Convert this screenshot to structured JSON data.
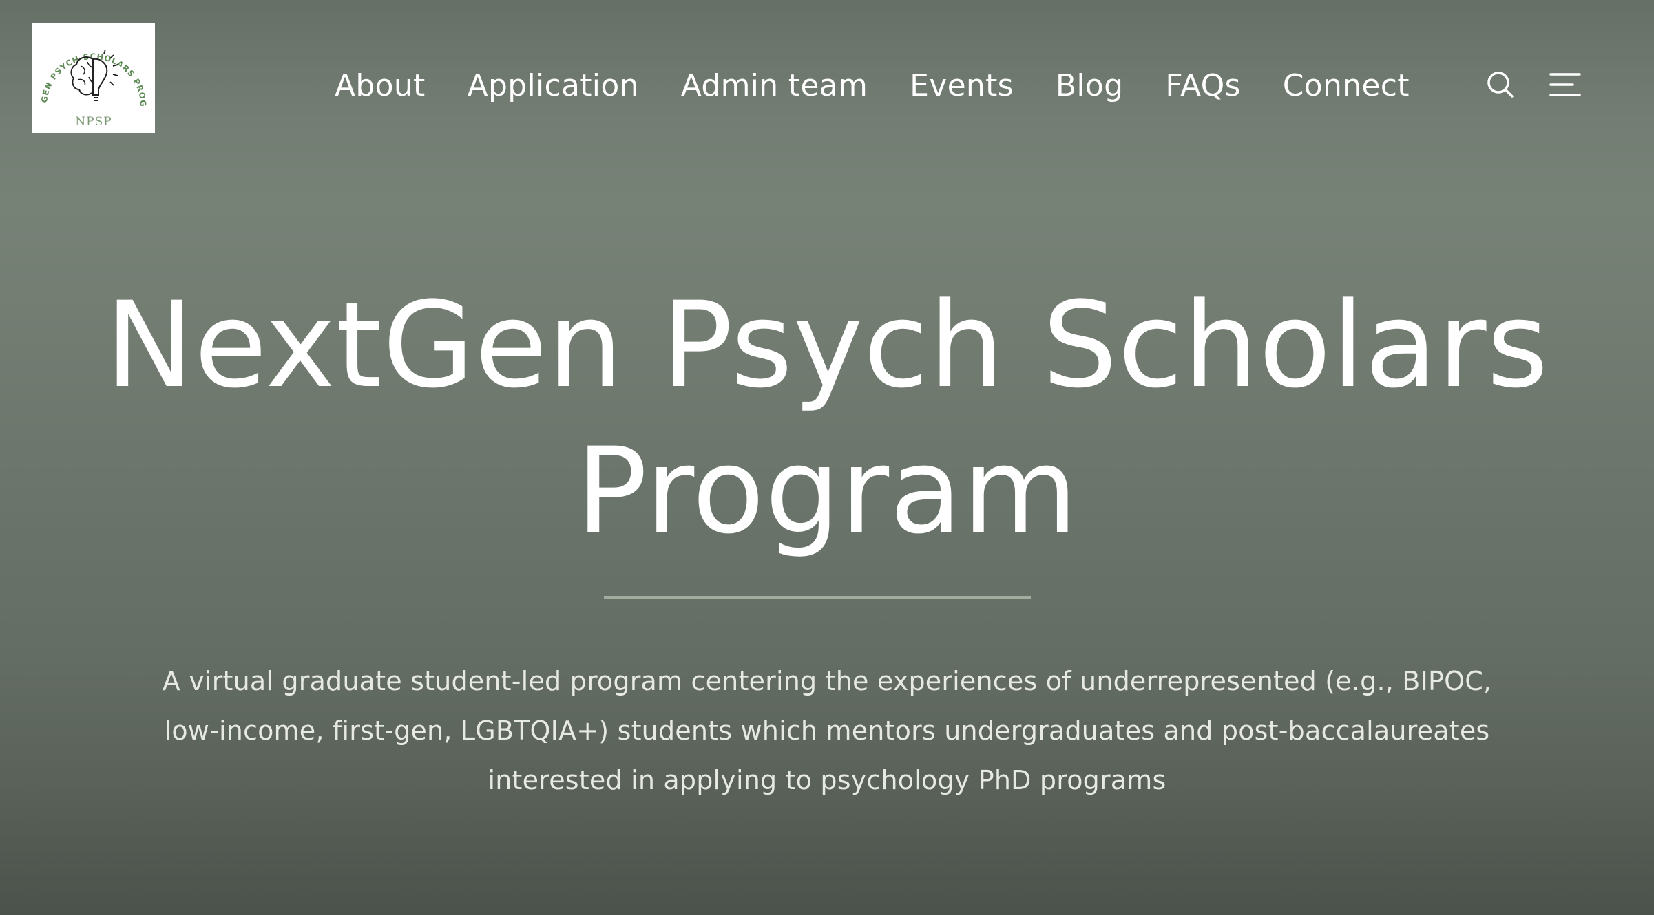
{
  "site": {
    "logo": {
      "ring_text": "NEXTGEN PSYCH SCHOLARS PROGRAM",
      "abbreviation": "NPSP",
      "icon": "brain-lightbulb-icon"
    }
  },
  "nav": {
    "items": [
      {
        "label": "About"
      },
      {
        "label": "Application"
      },
      {
        "label": "Admin team"
      },
      {
        "label": "Events"
      },
      {
        "label": "Blog"
      },
      {
        "label": "FAQs"
      },
      {
        "label": "Connect"
      }
    ],
    "search_icon": "search-icon",
    "menu_icon": "menu-icon"
  },
  "hero": {
    "title_line1": "NextGen Psych Scholars",
    "title_line2": "Program",
    "subtitle_line1": "A virtual graduate student-led program centering the experiences of underrepresented (e.g., BIPOC,",
    "subtitle_line2": "low-income, first-gen, LGBTQIA+) students which mentors undergraduates and post-baccalaureates",
    "subtitle_line3": "interested in applying to psychology PhD programs"
  },
  "colors": {
    "background": "#737d73",
    "text": "#ffffff",
    "subtitle_text": "#e7eae3",
    "logo_green": "#5e8a55"
  }
}
